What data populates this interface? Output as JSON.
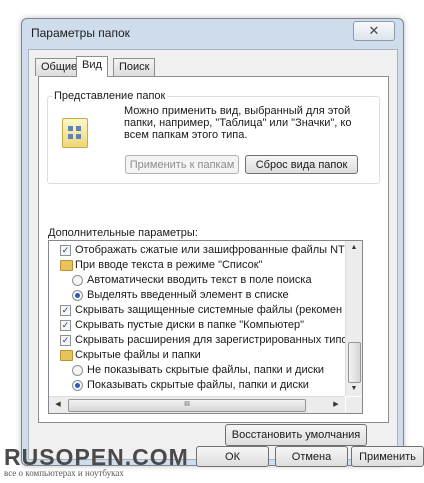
{
  "window": {
    "title": "Параметры папок"
  },
  "tabs": [
    {
      "label": "Общие",
      "active": false
    },
    {
      "label": "Вид",
      "active": true
    },
    {
      "label": "Поиск",
      "active": false
    }
  ],
  "folder_views": {
    "label": "Представление папок",
    "description": "Можно применить вид, выбранный для этой папки, например, \"Таблица\" или \"Значки\", ко всем папкам этого типа.",
    "apply_button": "Применить к папкам",
    "apply_disabled": true,
    "reset_button": "Сброс вида папок"
  },
  "advanced": {
    "label": "Дополнительные параметры:",
    "items": [
      {
        "type": "checkbox",
        "checked": true,
        "indent": 1,
        "label": "Отображать сжатые или зашифрованные файлы NTI"
      },
      {
        "type": "folder",
        "indent": 1,
        "label": "При вводе текста в режиме \"Список\""
      },
      {
        "type": "radio",
        "checked": false,
        "indent": 2,
        "label": "Автоматически вводить текст в поле поиска"
      },
      {
        "type": "radio",
        "checked": true,
        "indent": 2,
        "label": "Выделять введенный элемент в списке"
      },
      {
        "type": "checkbox",
        "checked": true,
        "indent": 1,
        "label": "Скрывать защищенные системные файлы (рекомен"
      },
      {
        "type": "checkbox",
        "checked": true,
        "indent": 1,
        "label": "Скрывать пустые диски в папке \"Компьютер\""
      },
      {
        "type": "checkbox",
        "checked": true,
        "indent": 1,
        "label": "Скрывать расширения для зарегистрированных типо"
      },
      {
        "type": "folder",
        "indent": 1,
        "label": "Скрытые файлы и папки"
      },
      {
        "type": "radio",
        "checked": false,
        "indent": 2,
        "label": "Не показывать скрытые файлы, папки и диски"
      },
      {
        "type": "radio",
        "checked": true,
        "indent": 2,
        "label": "Показывать скрытые файлы, папки и диски"
      }
    ],
    "restore_button": "Восстановить умолчания"
  },
  "footer": {
    "ok": "ОК",
    "cancel": "Отмена",
    "apply": "Применить"
  },
  "watermark": {
    "logo": "RUSOPEN.COM",
    "tagline": "все о компьютерах и ноутбуках"
  },
  "colors": {
    "window_frame": "#cfdcec",
    "client": "#f0f0f0",
    "radio_dot": "#2b5eb8",
    "folder": "#e8c25b"
  },
  "icons": {
    "close": "close-icon",
    "folder_view": "folder-view-icon",
    "scroll_up": "arrow-up-icon",
    "scroll_down": "arrow-down-icon",
    "scroll_left": "arrow-left-icon",
    "scroll_right": "arrow-right-icon"
  }
}
